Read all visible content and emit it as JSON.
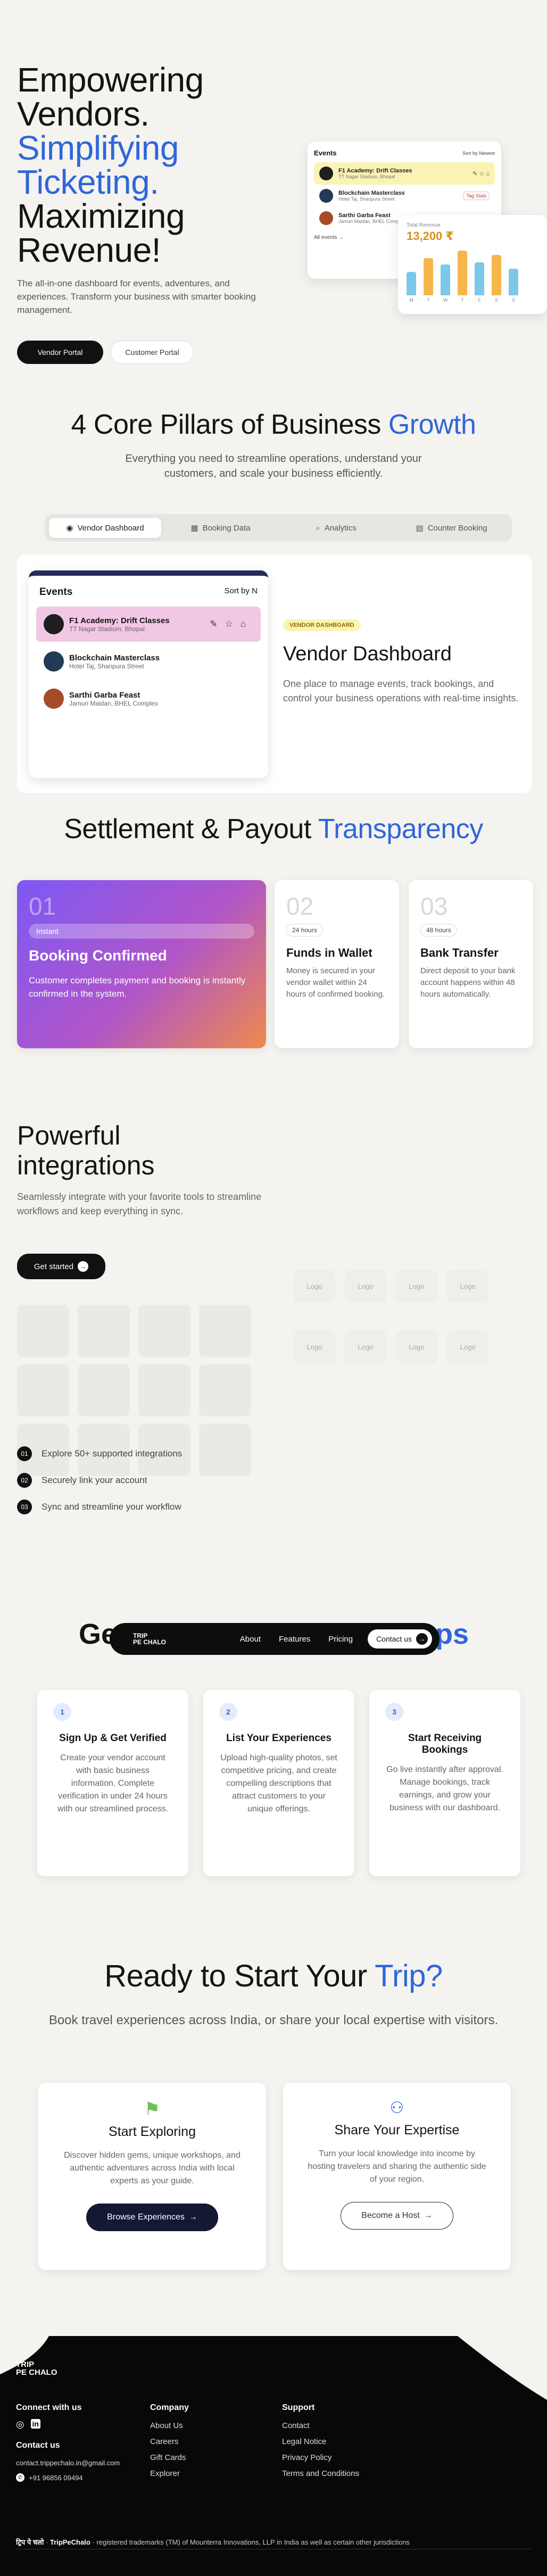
{
  "hero": {
    "title_1": "Empowering",
    "title_2": "Vendors.",
    "title_3": "Simplifying",
    "title_4": "Ticketing.",
    "title_5": "Maximizing",
    "title_6": "Revenue!",
    "subtitle": "The all-in-one dashboard for events, adventures, and experiences. Transform your business with smarter booking management.",
    "vendor_portal": "Vendor Portal",
    "customer_portal": "Customer Portal",
    "mock": {
      "events_title": "Events",
      "sort": "Sort by Newest",
      "rows": [
        {
          "name": "F1 Academy: Drift Classes",
          "place": "TT Nagar Stadium, Bhopal"
        },
        {
          "name": "Blockchain Masterclass",
          "place": "Hotel Taj, Shanpura Street",
          "tag": "Tag Stats"
        },
        {
          "name": "Sarthi Garba Feast",
          "place": "Jamuri Maidan, BHEL Complex"
        }
      ],
      "all_events": "All events",
      "revenue_label": "Total Revenue",
      "revenue_value": "13,200 ₹",
      "days": [
        "M",
        "T",
        "W",
        "T",
        "F",
        "S",
        "S"
      ]
    }
  },
  "pillars": {
    "title": "4 Core Pillars of Business",
    "title_accent": "Growth",
    "subtitle": "Everything you need to streamline operations, understand your customers, and scale your business efficiently.",
    "tabs": [
      "Vendor Dashboard",
      "Booking Data",
      "Analytics",
      "Counter Booking"
    ],
    "panel": {
      "events": "Events",
      "sort": "Sort by N",
      "rows": [
        {
          "name": "F1 Academy: Drift Classes",
          "place": "TT Nagar Stadium, Bhopal"
        },
        {
          "name": "Blockchain Masterclass",
          "place": "Hotel Taj, Shanpura Street"
        },
        {
          "name": "Sarthi Garba Feast",
          "place": "Jamuri Maidan, BHEL Complex"
        }
      ],
      "badge": "VENDOR DASHBOARD",
      "heading": "Vendor Dashboard",
      "desc": "One place to manage events, track bookings, and control your business operations with real-time insights."
    }
  },
  "payout": {
    "title": "Settlement & Payout",
    "title_accent": "Transparency",
    "cards": [
      {
        "num": "01",
        "pill": "Instant",
        "title": "Booking Confirmed",
        "desc": "Customer completes payment and booking is instantly confirmed in the system."
      },
      {
        "num": "02",
        "pill": "24 hours",
        "title": "Funds in Wallet",
        "desc": "Money is secured in your vendor wallet within 24 hours of confirmed booking."
      },
      {
        "num": "03",
        "pill": "48 hours",
        "title": "Bank Transfer",
        "desc": "Direct deposit to your bank account happens within 48 hours automatically."
      }
    ]
  },
  "integrations": {
    "title_1": "Powerful",
    "title_2": "integrations",
    "subtitle": "Seamlessly integrate with your favorite tools to streamline workflows and keep everything in sync.",
    "cta": "Get started",
    "logo_label": "Logo",
    "items": [
      "Explore 50+ supported integrations",
      "Securely link your account",
      "Sync and streamline your workflow"
    ],
    "nums": [
      "01",
      "02",
      "03"
    ]
  },
  "nav": {
    "logo_1": "TRIP",
    "logo_2": "PE CHALO",
    "about": "About",
    "features": "Features",
    "pricing": "Pricing",
    "contact": "Contact us"
  },
  "steps": {
    "title_left": "Ge",
    "title_right": "ps",
    "cards": [
      {
        "n": "1",
        "title": "Sign Up & Get Verified",
        "desc": "Create your vendor account with basic business information. Complete verification in under 24 hours with our streamlined process."
      },
      {
        "n": "2",
        "title": "List Your Experiences",
        "desc": "Upload high-quality photos, set competitive pricing, and create compelling descriptions that attract customers to your unique offerings."
      },
      {
        "n": "3",
        "title": "Start Receiving Bookings",
        "desc": "Go live instantly after approval. Manage bookings, track earnings, and grow your business with our dashboard."
      }
    ]
  },
  "cta": {
    "title": "Ready to Start Your",
    "title_accent": "Trip?",
    "subtitle": "Book travel experiences across India, or share your local expertise with visitors.",
    "cards": [
      {
        "title": "Start Exploring",
        "desc": "Discover hidden gems, unique workshops, and authentic adventures across India with local experts as your guide.",
        "button": "Browse Experiences"
      },
      {
        "title": "Share Your Expertise",
        "desc": "Turn your local knowledge into income by hosting travelers and sharing the authentic side of your region.",
        "button": "Become a Host"
      }
    ]
  },
  "footer": {
    "logo_1": "TRIP",
    "logo_2": "PE CHALO",
    "connect": "Connect with us",
    "contact_title": "Contact us",
    "email": "contact.trippechalo.in@gmail.com",
    "phone": "+91 96856 09494",
    "company_title": "Company",
    "company_links": [
      "About Us",
      "Careers",
      "Gift Cards",
      "Explorer"
    ],
    "support_title": "Support",
    "support_links": [
      "Contact",
      "Legal Notice",
      "Privacy Policy",
      "Terms and Conditions"
    ],
    "legal_1": "ट्रिप पे चलो",
    "legal_2": "TripPeChalo",
    "legal_3": "registered trademarks (TM) of Mounterra Innovations, LLP in India as well as certain other jurisdictions"
  },
  "colors": {
    "accent": "#2f66d9",
    "highlight": "#f2c7e3",
    "yellow": "#fbf3b3"
  }
}
